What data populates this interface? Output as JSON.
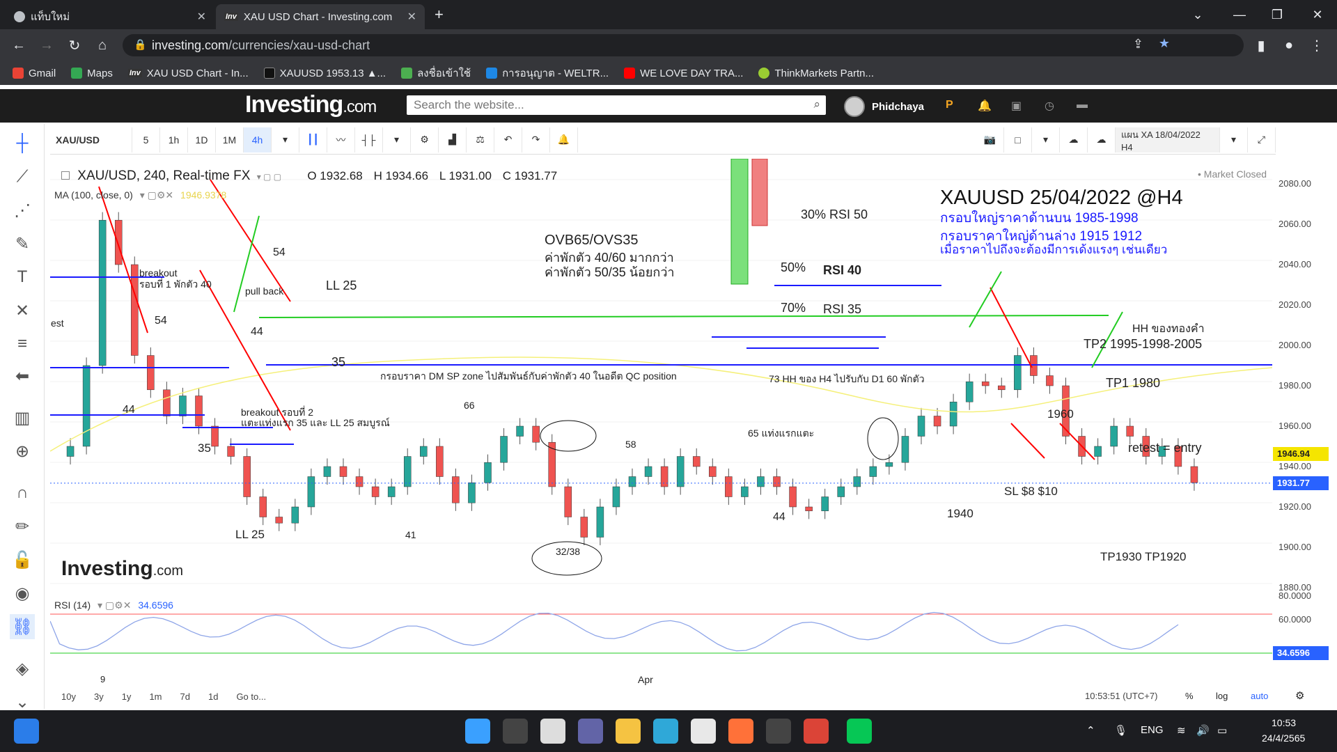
{
  "browser": {
    "tabs": [
      {
        "label": "แท็บใหม่"
      },
      {
        "label": "XAU USD Chart - Investing.com"
      }
    ],
    "new_tab": "+",
    "url_host": "investing.com",
    "url_path": "/currencies/xau-usd-chart",
    "bookmarks": [
      {
        "label": "Gmail",
        "color": "#ea4335"
      },
      {
        "label": "Maps",
        "color": "#34a853"
      },
      {
        "label": "XAU USD Chart - In...",
        "color": "#333333"
      },
      {
        "label": "XAUUSD 1953.13 ▲...",
        "color": "#111111"
      },
      {
        "label": "ลงชื่อเข้าใช้",
        "color": "#4caf50"
      },
      {
        "label": "การอนุญาต - WELTR...",
        "color": "#1e88e5"
      },
      {
        "label": "WE LOVE DAY TRA...",
        "color": "#ff0000"
      },
      {
        "label": "ThinkMarkets Partn...",
        "color": "#9acd32"
      }
    ]
  },
  "site": {
    "logo": "Investing",
    "logo_com": ".com",
    "search_placeholder": "Search the website...",
    "username": "Phidchaya"
  },
  "toolbar": {
    "symbol": "XAU/USD",
    "intervals": [
      "5",
      "1h",
      "1D",
      "1M",
      "4h"
    ],
    "active_interval": "4h",
    "layout_name": "แผน XA 18/04/2022 H4"
  },
  "chart": {
    "title": "XAU/USD, 240, Real-time FX",
    "open": "O 1932.68",
    "high": "H 1934.66",
    "low": "L 1931.00",
    "close": "C 1931.77",
    "ma_label": "MA (100, close, 0)",
    "ma_value": "1946.9378",
    "market_status": "• Market Closed",
    "watermark": "Investing",
    "watermark_com": ".com",
    "current_price": "1931.77",
    "ma_price": "1946.94",
    "price_ticks": [
      "2080.00",
      "2060.00",
      "2040.00",
      "2020.00",
      "2000.00",
      "1980.00",
      "1960.00",
      "1940.00",
      "1920.00",
      "1900.00",
      "1880.00"
    ],
    "rsi_label": "RSI (14)",
    "rsi_value": "34.6596",
    "rsi_ticks": [
      "80.0000",
      "60.0000"
    ],
    "x_labels": [
      "9",
      "Apr"
    ]
  },
  "annotations": {
    "heading": "XAUUSD 25/04/2022 @H4",
    "blue_lines": [
      "กรอบใหญ่ราคาด้านบน 1985-1998",
      "กรอบราคาใหญ่ด้านล่าง 1915 1912",
      "เมื่อราคาไปถึงจะต้องมีการเด้งแรงๆ เช่นเดียว"
    ],
    "ovb": [
      "OVB65/OVS35",
      "ค่าพักตัว 40/60 มากกว่า",
      "ค่าพักตัว 50/35 น้อยกว่า"
    ],
    "rsi30": "30% RSI 50",
    "pct50": "50%",
    "rsi40": "RSI 40",
    "pct70": "70%",
    "rsi35": "RSI 35",
    "hh_gold": "HH ของทองคำ",
    "tp2": "TP2 1995-1998-2005",
    "tp1": "TP1 1980",
    "l1960": "1960",
    "retest": "retest = entry",
    "sl": "SL $8 $10",
    "l1940": "1940",
    "tp_low": "TP1930 TP1920",
    "dm_zone": "กรอบราคา DM SP zone ไปสัมพันธ์กับค่าพักตัว 40 ในอดีต QC position",
    "hh73": "73 HH ของ H4 ไปรับกับ D1 60 พักตัว",
    "t65": "65 แท่งแรกแตะ",
    "breakout1": "breakout",
    "breakout1b": "รอบที่ 1 พักตัว 40",
    "pullback": "pull back",
    "n54a": "54",
    "n54b": "54",
    "n44a": "44",
    "n44b": "44",
    "n44c": "44",
    "ll25a": "LL 25",
    "ll25b": "LL 25",
    "n35a": "35",
    "n35b": "35",
    "breakout2": "breakout รอบที่ 2",
    "breakout2b": "แตะแท่งแรก 35 และ LL 25 สมบูรณ์",
    "n66": "66",
    "n58": "58",
    "n41": "41",
    "n3238": "32/38",
    "est": "est"
  },
  "bottom_bar": {
    "ranges": [
      "10y",
      "3y",
      "1y",
      "1m",
      "7d",
      "1d",
      "Go to..."
    ],
    "time": "10:53:51 (UTC+7)",
    "pct": "%",
    "log": "log",
    "auto": "auto"
  },
  "taskbar": {
    "lang": "ENG",
    "time": "10:53",
    "date": "24/4/2565"
  },
  "colors": {
    "up": "#26a69a",
    "down": "#ef5350",
    "ma": "#f5f07a",
    "annot_blue": "#1a1aff",
    "annot_red": "#ff0000",
    "annot_green": "#22cc22"
  }
}
